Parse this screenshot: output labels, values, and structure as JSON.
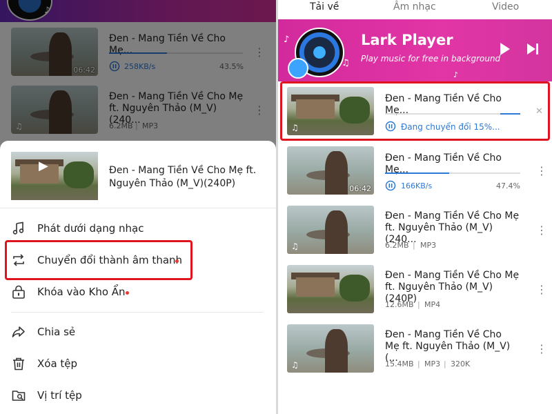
{
  "left": {
    "items": [
      {
        "title": "Đen - Mang Tiền Về Cho Mẹ...",
        "duration": "06:42",
        "speed": "258KB/s",
        "percent": "43.5%",
        "progress": 0.435
      },
      {
        "title_line1": "Đen - Mang Tiền Về Cho Mẹ",
        "title_line2": "ft. Nguyên Thảo (M_V)(240...",
        "size": "6.2MB",
        "format": "MP3"
      }
    ],
    "sheet": {
      "title": "Đen - Mang Tiền Về Cho Mẹ ft. Nguyên Thảo (M_V)(240P)",
      "menu": [
        {
          "label": "Phát dưới dạng nhạc",
          "icon": "music-note-icon"
        },
        {
          "label": "Chuyển đổi thành âm thanh",
          "icon": "convert-icon"
        },
        {
          "label": "Khóa vào Kho Ẩn",
          "icon": "lock-icon"
        },
        {
          "label": "Chia sẻ",
          "icon": "share-icon"
        },
        {
          "label": "Xóa tệp",
          "icon": "trash-icon"
        },
        {
          "label": "Vị trí tệp",
          "icon": "folder-location-icon"
        }
      ]
    }
  },
  "right": {
    "tabs": [
      "Tải về",
      "Âm nhạc",
      "Video"
    ],
    "banner": {
      "title": "Lark Player",
      "subtitle": "Play music for free in background"
    },
    "items": [
      {
        "title": "Đen - Mang Tiền Về Cho Mẹ...",
        "status": "Đang chuyển đổi 15%...",
        "progress": 0.15
      },
      {
        "title": "Đen - Mang Tiền Về Cho Mẹ...",
        "duration": "06:42",
        "speed": "166KB/s",
        "percent": "47.4%",
        "progress": 0.474
      },
      {
        "title_line1": "Đen - Mang Tiền Về Cho Mẹ",
        "title_line2": "ft. Nguyên Thảo (M_V)(240...",
        "size": "6.2MB",
        "format": "MP3"
      },
      {
        "title_line1": "Đen - Mang Tiền Về Cho Mẹ",
        "title_line2": "ft. Nguyên Thảo (M_V)(240P)",
        "size": "12.6MB",
        "format": "MP4"
      },
      {
        "title_line1": "Đen - Mang Tiền Về Cho",
        "title_line2": "Mẹ ft. Nguyên Thảo (M_V)(...",
        "size": "15.4MB",
        "format": "MP3",
        "bitrate": "320K"
      }
    ]
  },
  "colors": {
    "accent": "#2b79d6",
    "highlight": "#e0141e",
    "banner": "#d22a9c"
  }
}
